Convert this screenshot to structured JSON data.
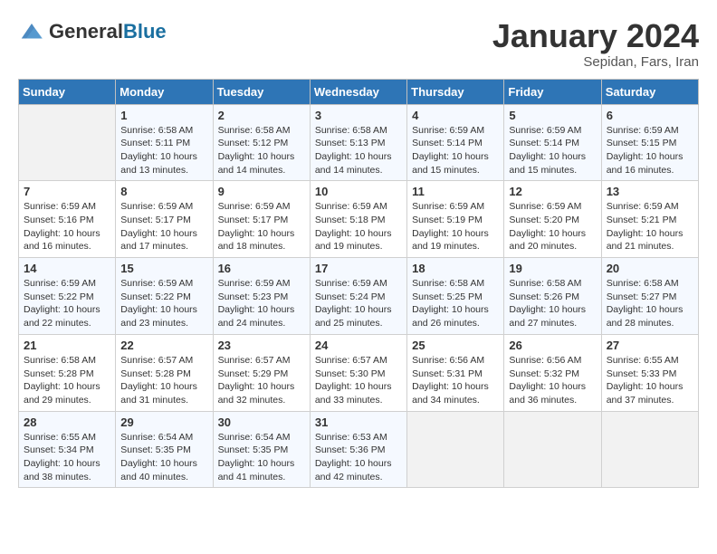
{
  "header": {
    "logo_general": "General",
    "logo_blue": "Blue",
    "month_title": "January 2024",
    "subtitle": "Sepidan, Fars, Iran"
  },
  "days_of_week": [
    "Sunday",
    "Monday",
    "Tuesday",
    "Wednesday",
    "Thursday",
    "Friday",
    "Saturday"
  ],
  "weeks": [
    [
      {
        "day": "",
        "sunrise": "",
        "sunset": "",
        "daylight": ""
      },
      {
        "day": "1",
        "sunrise": "Sunrise: 6:58 AM",
        "sunset": "Sunset: 5:11 PM",
        "daylight": "Daylight: 10 hours and 13 minutes."
      },
      {
        "day": "2",
        "sunrise": "Sunrise: 6:58 AM",
        "sunset": "Sunset: 5:12 PM",
        "daylight": "Daylight: 10 hours and 14 minutes."
      },
      {
        "day": "3",
        "sunrise": "Sunrise: 6:58 AM",
        "sunset": "Sunset: 5:13 PM",
        "daylight": "Daylight: 10 hours and 14 minutes."
      },
      {
        "day": "4",
        "sunrise": "Sunrise: 6:59 AM",
        "sunset": "Sunset: 5:14 PM",
        "daylight": "Daylight: 10 hours and 15 minutes."
      },
      {
        "day": "5",
        "sunrise": "Sunrise: 6:59 AM",
        "sunset": "Sunset: 5:14 PM",
        "daylight": "Daylight: 10 hours and 15 minutes."
      },
      {
        "day": "6",
        "sunrise": "Sunrise: 6:59 AM",
        "sunset": "Sunset: 5:15 PM",
        "daylight": "Daylight: 10 hours and 16 minutes."
      }
    ],
    [
      {
        "day": "7",
        "sunrise": "Sunrise: 6:59 AM",
        "sunset": "Sunset: 5:16 PM",
        "daylight": "Daylight: 10 hours and 16 minutes."
      },
      {
        "day": "8",
        "sunrise": "Sunrise: 6:59 AM",
        "sunset": "Sunset: 5:17 PM",
        "daylight": "Daylight: 10 hours and 17 minutes."
      },
      {
        "day": "9",
        "sunrise": "Sunrise: 6:59 AM",
        "sunset": "Sunset: 5:17 PM",
        "daylight": "Daylight: 10 hours and 18 minutes."
      },
      {
        "day": "10",
        "sunrise": "Sunrise: 6:59 AM",
        "sunset": "Sunset: 5:18 PM",
        "daylight": "Daylight: 10 hours and 19 minutes."
      },
      {
        "day": "11",
        "sunrise": "Sunrise: 6:59 AM",
        "sunset": "Sunset: 5:19 PM",
        "daylight": "Daylight: 10 hours and 19 minutes."
      },
      {
        "day": "12",
        "sunrise": "Sunrise: 6:59 AM",
        "sunset": "Sunset: 5:20 PM",
        "daylight": "Daylight: 10 hours and 20 minutes."
      },
      {
        "day": "13",
        "sunrise": "Sunrise: 6:59 AM",
        "sunset": "Sunset: 5:21 PM",
        "daylight": "Daylight: 10 hours and 21 minutes."
      }
    ],
    [
      {
        "day": "14",
        "sunrise": "Sunrise: 6:59 AM",
        "sunset": "Sunset: 5:22 PM",
        "daylight": "Daylight: 10 hours and 22 minutes."
      },
      {
        "day": "15",
        "sunrise": "Sunrise: 6:59 AM",
        "sunset": "Sunset: 5:22 PM",
        "daylight": "Daylight: 10 hours and 23 minutes."
      },
      {
        "day": "16",
        "sunrise": "Sunrise: 6:59 AM",
        "sunset": "Sunset: 5:23 PM",
        "daylight": "Daylight: 10 hours and 24 minutes."
      },
      {
        "day": "17",
        "sunrise": "Sunrise: 6:59 AM",
        "sunset": "Sunset: 5:24 PM",
        "daylight": "Daylight: 10 hours and 25 minutes."
      },
      {
        "day": "18",
        "sunrise": "Sunrise: 6:58 AM",
        "sunset": "Sunset: 5:25 PM",
        "daylight": "Daylight: 10 hours and 26 minutes."
      },
      {
        "day": "19",
        "sunrise": "Sunrise: 6:58 AM",
        "sunset": "Sunset: 5:26 PM",
        "daylight": "Daylight: 10 hours and 27 minutes."
      },
      {
        "day": "20",
        "sunrise": "Sunrise: 6:58 AM",
        "sunset": "Sunset: 5:27 PM",
        "daylight": "Daylight: 10 hours and 28 minutes."
      }
    ],
    [
      {
        "day": "21",
        "sunrise": "Sunrise: 6:58 AM",
        "sunset": "Sunset: 5:28 PM",
        "daylight": "Daylight: 10 hours and 29 minutes."
      },
      {
        "day": "22",
        "sunrise": "Sunrise: 6:57 AM",
        "sunset": "Sunset: 5:28 PM",
        "daylight": "Daylight: 10 hours and 31 minutes."
      },
      {
        "day": "23",
        "sunrise": "Sunrise: 6:57 AM",
        "sunset": "Sunset: 5:29 PM",
        "daylight": "Daylight: 10 hours and 32 minutes."
      },
      {
        "day": "24",
        "sunrise": "Sunrise: 6:57 AM",
        "sunset": "Sunset: 5:30 PM",
        "daylight": "Daylight: 10 hours and 33 minutes."
      },
      {
        "day": "25",
        "sunrise": "Sunrise: 6:56 AM",
        "sunset": "Sunset: 5:31 PM",
        "daylight": "Daylight: 10 hours and 34 minutes."
      },
      {
        "day": "26",
        "sunrise": "Sunrise: 6:56 AM",
        "sunset": "Sunset: 5:32 PM",
        "daylight": "Daylight: 10 hours and 36 minutes."
      },
      {
        "day": "27",
        "sunrise": "Sunrise: 6:55 AM",
        "sunset": "Sunset: 5:33 PM",
        "daylight": "Daylight: 10 hours and 37 minutes."
      }
    ],
    [
      {
        "day": "28",
        "sunrise": "Sunrise: 6:55 AM",
        "sunset": "Sunset: 5:34 PM",
        "daylight": "Daylight: 10 hours and 38 minutes."
      },
      {
        "day": "29",
        "sunrise": "Sunrise: 6:54 AM",
        "sunset": "Sunset: 5:35 PM",
        "daylight": "Daylight: 10 hours and 40 minutes."
      },
      {
        "day": "30",
        "sunrise": "Sunrise: 6:54 AM",
        "sunset": "Sunset: 5:35 PM",
        "daylight": "Daylight: 10 hours and 41 minutes."
      },
      {
        "day": "31",
        "sunrise": "Sunrise: 6:53 AM",
        "sunset": "Sunset: 5:36 PM",
        "daylight": "Daylight: 10 hours and 42 minutes."
      },
      {
        "day": "",
        "sunrise": "",
        "sunset": "",
        "daylight": ""
      },
      {
        "day": "",
        "sunrise": "",
        "sunset": "",
        "daylight": ""
      },
      {
        "day": "",
        "sunrise": "",
        "sunset": "",
        "daylight": ""
      }
    ]
  ]
}
